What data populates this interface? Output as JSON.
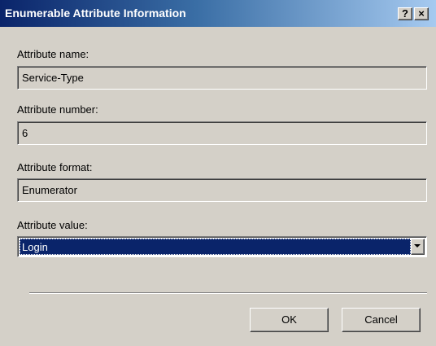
{
  "window": {
    "title": "Enumerable Attribute Information",
    "help_glyph": "?",
    "close_glyph": "×"
  },
  "attribute_name": {
    "label": "Attribute name:",
    "value": "Service-Type"
  },
  "attribute_number": {
    "label": "Attribute number:",
    "value": "6"
  },
  "attribute_format": {
    "label": "Attribute format:",
    "value": "Enumerator"
  },
  "attribute_value": {
    "label": "Attribute value:",
    "selected": "Login"
  },
  "buttons": {
    "ok_label": "OK",
    "cancel_label": "Cancel"
  },
  "colors": {
    "titlebar_start": "#0a246a",
    "titlebar_end": "#a6caf0",
    "dialog_face": "#d4d0c8",
    "selection": "#0a246a"
  },
  "icons": {
    "help": "help-icon",
    "close": "close-icon",
    "dropdown": "chevron-down-icon"
  }
}
